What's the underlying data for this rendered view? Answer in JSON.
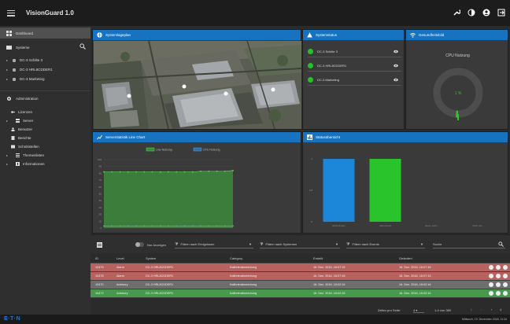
{
  "app": {
    "title": "VisionGuard 1.0"
  },
  "topbar": {
    "icons": [
      "wrench-icon",
      "contrast-icon",
      "user-icon",
      "exit-icon"
    ]
  },
  "sidebar": {
    "dashboard_label": "Dashboard",
    "systems_label": "Systeme",
    "systems": [
      "DC-3 Schilte 3",
      "DC-3 HRL8CDDER1",
      "DC-3 Marketing"
    ],
    "admin_label": "Administration",
    "admin_items": [
      "Lizenzen",
      "Server",
      "Benutzer",
      "Berichte",
      "Schnittstellen",
      "Themenlisten",
      "Informationen"
    ]
  },
  "panels": {
    "map_title": "Systemlageplan",
    "status_title": "Systemstatus",
    "status_items": [
      "DC-3 Schilte 3",
      "DC-3 HRL8CDDER1",
      "DC-3 Marketing"
    ],
    "gauge_title": "Gesundheitsbild",
    "gauge_label": "CPU Nutzung",
    "gauge_value": "1 %",
    "gauge_fraction": 0.01,
    "line_title": "Serverstatistik Line Chart",
    "bar_title": "Statusübersicht"
  },
  "chart_data": [
    {
      "type": "line",
      "title": "Serverstatistik Line Chart",
      "series": [
        {
          "name": "Line Nutzung",
          "values": [
            82,
            82,
            82,
            82,
            82,
            82,
            82,
            82,
            82,
            82,
            82,
            82,
            83,
            83,
            83,
            83,
            84
          ]
        },
        {
          "name": "CPU Nutzung",
          "values": [
            3,
            3,
            3,
            3,
            3,
            3,
            3,
            3,
            3,
            3,
            3,
            3,
            3,
            3,
            3,
            3,
            3
          ]
        }
      ],
      "ylim": [
        0,
        100
      ],
      "yticks": [
        "100",
        "90",
        "80",
        "70",
        "60",
        "50",
        "40",
        "30",
        "20",
        "10",
        "0"
      ]
    },
    {
      "type": "bar",
      "title": "Statusübersicht",
      "categories": [
        "Schlieflodern",
        "Alarmstand",
        "Neuer Fehl...",
        "Nicht Ver..."
      ],
      "values": [
        1,
        1,
        0,
        0
      ],
      "colors": [
        "#1c86d9",
        "#29c42b",
        "#888888",
        "#888888"
      ],
      "ylim": [
        0,
        1.1
      ]
    }
  ],
  "filterbar": {
    "toggle_label": "Nur Anzeigen",
    "filter1": "Filtern nach Ereignissen",
    "filter2": "Filtern nach Systemen",
    "filter3": "Filtern nach Events",
    "search_placeholder": "Suche"
  },
  "table": {
    "headers": [
      "ID",
      "Level",
      "System",
      "Category",
      "Erstellt",
      "Geändert"
    ],
    "rows": [
      {
        "id": "10475",
        "level": "Alarm",
        "system": "DC-3 HRL8CDDER1",
        "category": "Kalibrierabweichung",
        "created": "16. Dez. 2016, 16:07:15",
        "changed": "16. Dez. 2016, 16:07:15",
        "color": "#b86260"
      },
      {
        "id": "10476",
        "level": "Alarm",
        "system": "DC-3 HRL8CDDER1",
        "category": "Kalibrierabweichung",
        "created": "16. Dez. 2016, 16:07:15",
        "changed": "16. Dez. 2016, 16:07:15",
        "color": "#b86260"
      },
      {
        "id": "10470",
        "level": "Advisory",
        "system": "DC-3 HRL8CDDER1",
        "category": "Kalibrierabweichung",
        "created": "16. Dez. 2016, 16:02:16",
        "changed": "16. Dez. 2016, 16:02:16",
        "color": "#6e6e6e"
      },
      {
        "id": "10472",
        "level": "Advisory",
        "system": "DC-3 HRL8CDDER1",
        "category": "Kalibrierabweichung",
        "created": "16. Dez. 2016, 16:02:16",
        "changed": "16. Dez. 2016, 16:02:16",
        "color": "#479a4c"
      }
    ]
  },
  "pager": {
    "rows_label": "Zeilen pro Seite:",
    "rows_value": "4",
    "range": "1-4 von 380"
  },
  "footer": {
    "brand": "E·T·N",
    "clock": "Mittwoch, 19. Dezember 2018, 11:34"
  }
}
